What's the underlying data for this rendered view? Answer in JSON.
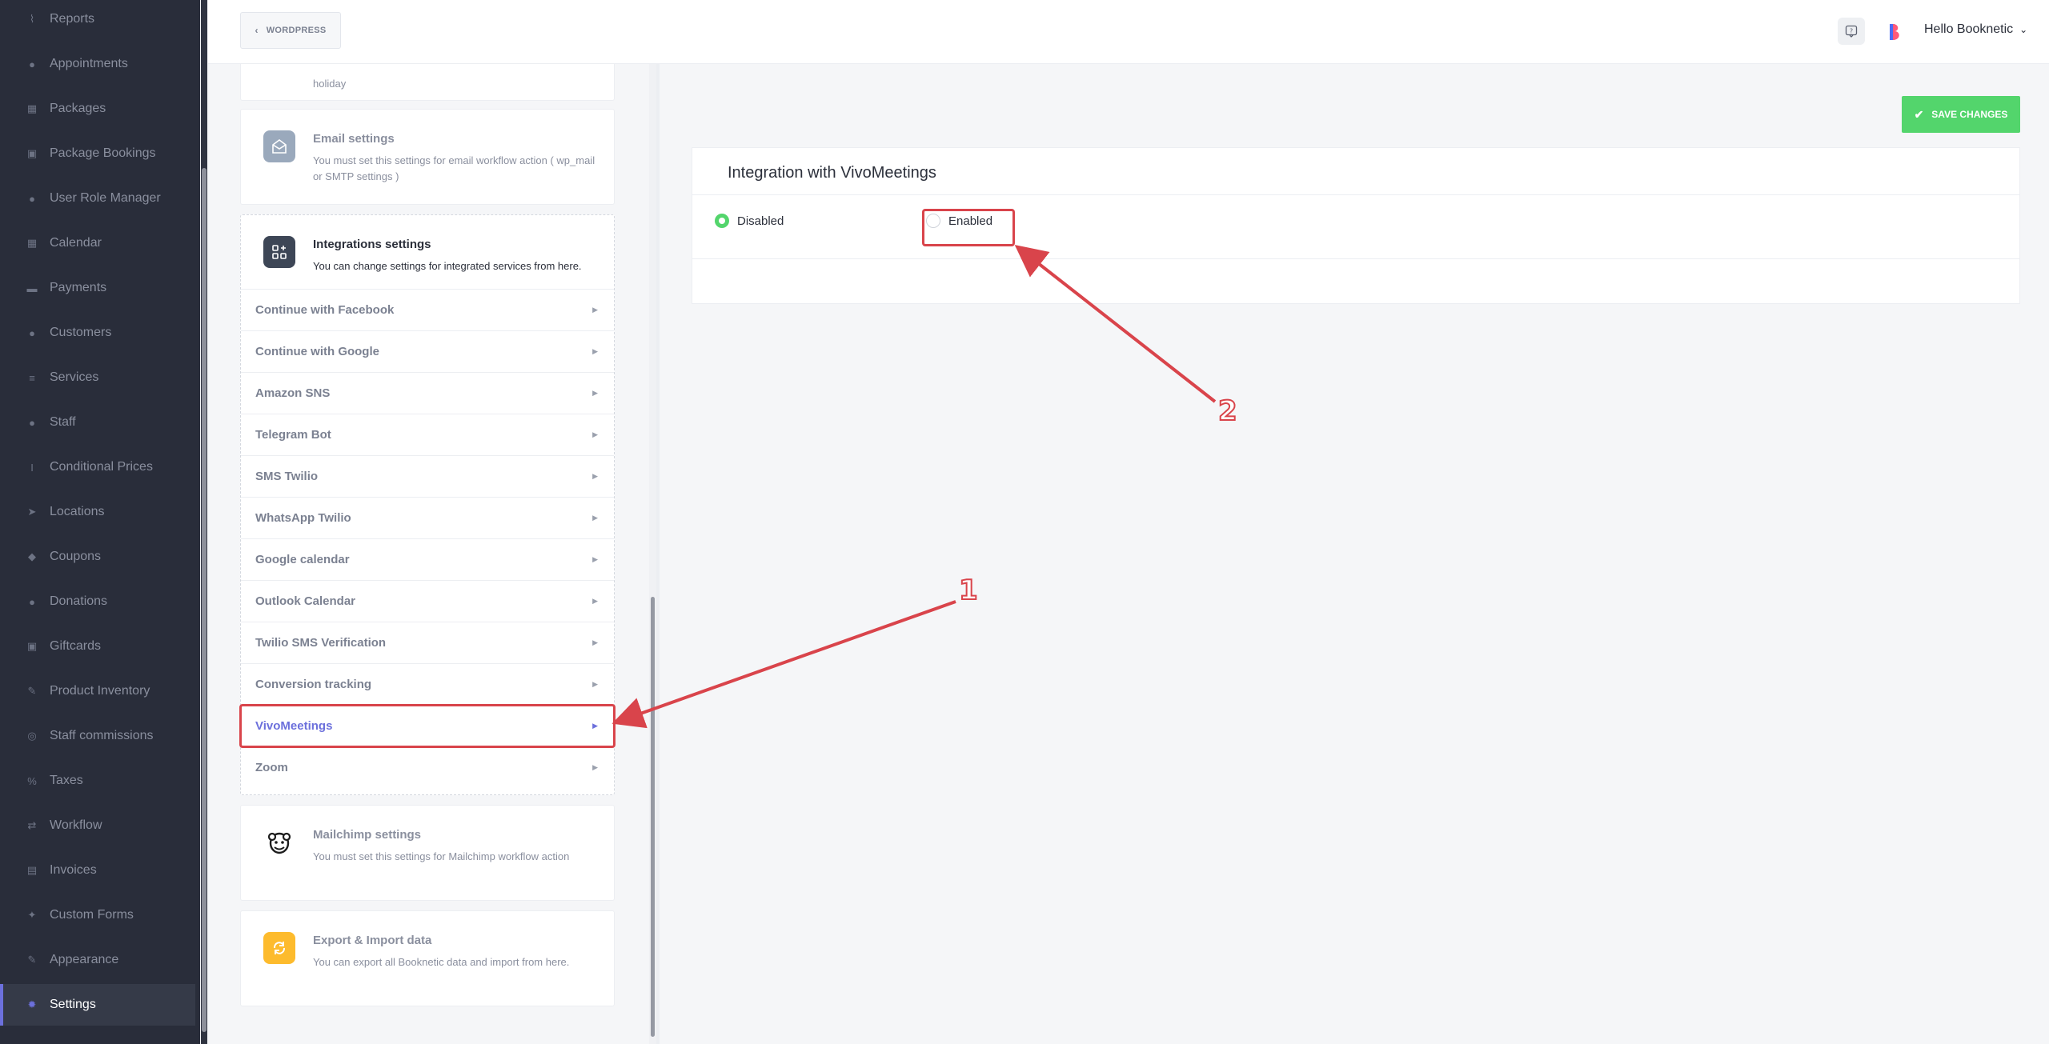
{
  "sidebar": {
    "items": [
      {
        "label": "Reports",
        "icon": "chart-icon"
      },
      {
        "label": "Appointments",
        "icon": "clock-icon"
      },
      {
        "label": "Packages",
        "icon": "boxes-icon"
      },
      {
        "label": "Package Bookings",
        "icon": "box-icon"
      },
      {
        "label": "User Role Manager",
        "icon": "user-plus-icon"
      },
      {
        "label": "Calendar",
        "icon": "calendar-icon"
      },
      {
        "label": "Payments",
        "icon": "payment-icon"
      },
      {
        "label": "Customers",
        "icon": "users-icon"
      },
      {
        "label": "Services",
        "icon": "list-icon"
      },
      {
        "label": "Staff",
        "icon": "user-icon"
      },
      {
        "label": "Conditional Prices",
        "icon": "cursor-icon"
      },
      {
        "label": "Locations",
        "icon": "location-arrow-icon"
      },
      {
        "label": "Coupons",
        "icon": "tag-icon"
      },
      {
        "label": "Donations",
        "icon": "donation-icon"
      },
      {
        "label": "Giftcards",
        "icon": "gift-icon"
      },
      {
        "label": "Product Inventory",
        "icon": "wrench-icon"
      },
      {
        "label": "Staff commissions",
        "icon": "coins-icon"
      },
      {
        "label": "Taxes",
        "icon": "percent-icon"
      },
      {
        "label": "Workflow",
        "icon": "workflow-icon"
      },
      {
        "label": "Invoices",
        "icon": "invoice-icon"
      },
      {
        "label": "Custom Forms",
        "icon": "wand-icon"
      },
      {
        "label": "Appearance",
        "icon": "brush-icon"
      },
      {
        "label": "Settings",
        "icon": "gear-icon",
        "active": true
      }
    ]
  },
  "topbar": {
    "wordpress_label": "WORDPRESS",
    "user_label": "Hello Booknetic"
  },
  "settings": {
    "holiday_desc": "holiday",
    "email": {
      "title": "Email settings",
      "desc": "You must set this settings for email workflow action ( wp_mail or SMTP settings )"
    },
    "integrations": {
      "title": "Integrations settings",
      "desc": "You can change settings for integrated services from here.",
      "items": [
        "Continue with Facebook",
        "Continue with Google",
        "Amazon SNS",
        "Telegram Bot",
        "SMS Twilio",
        "WhatsApp Twilio",
        "Google calendar",
        "Outlook Calendar",
        "Twilio SMS Verification",
        "Conversion tracking",
        "VivoMeetings",
        "Zoom"
      ],
      "active_item": "VivoMeetings"
    },
    "mailchimp": {
      "title": "Mailchimp settings",
      "desc": "You must set this settings for Mailchimp workflow action"
    },
    "export": {
      "title": "Export & Import data",
      "desc": "You can export all Booknetic data and import from here."
    }
  },
  "main": {
    "save_label": "SAVE CHANGES",
    "panel_title": "Integration with VivoMeetings",
    "options": [
      {
        "label": "Disabled",
        "selected": true
      },
      {
        "label": "Enabled",
        "selected": false
      }
    ]
  },
  "annotations": {
    "step1": "1",
    "step2": "2",
    "color": "#d9444b"
  },
  "colors": {
    "sidebar_bg": "#292d3a",
    "accent": "#6c70dc",
    "save_green": "#53d56c"
  }
}
